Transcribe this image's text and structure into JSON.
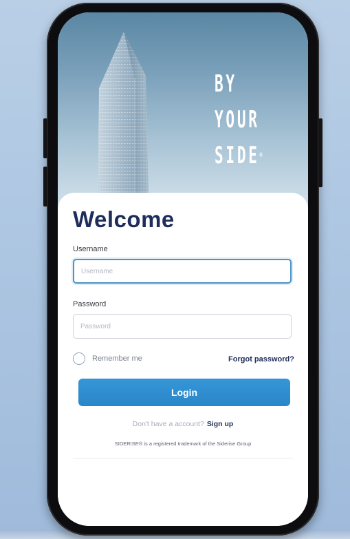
{
  "brand": {
    "tagline_lines": [
      "BY",
      "YOUR",
      "SIDE"
    ],
    "registered_mark": "®"
  },
  "login": {
    "title": "Welcome",
    "username_label": "Username",
    "username_placeholder": "Username",
    "password_label": "Password",
    "password_placeholder": "Password",
    "remember_label": "Remember me",
    "forgot_link": "Forgot password?",
    "login_button": "Login",
    "signup_prompt": "Don't have a account?",
    "signup_link": "Sign up",
    "trademark_notice": "SIDERISE® is a registered trademark of the Siderise Group"
  },
  "colors": {
    "brand_navy": "#1e2d5a",
    "accent_blue": "#2a86c8",
    "focus_border": "#4d93c7"
  }
}
